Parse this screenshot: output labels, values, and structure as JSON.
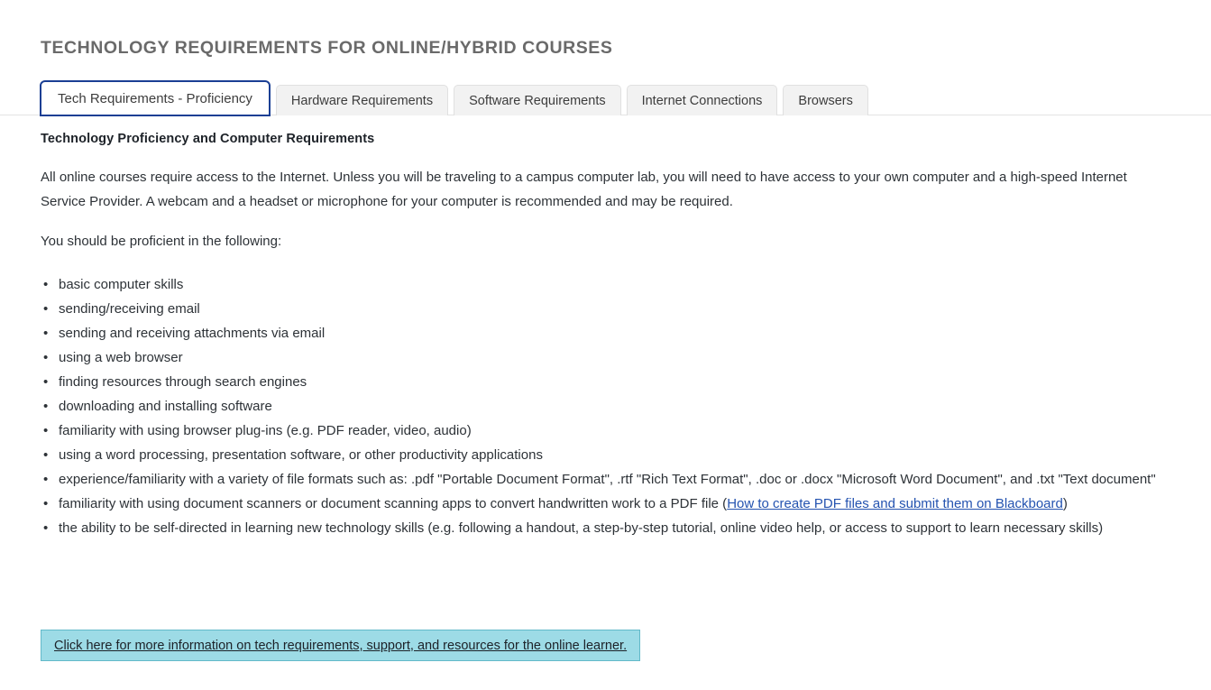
{
  "page": {
    "title": "TECHNOLOGY REQUIREMENTS FOR ONLINE/HYBRID COURSES"
  },
  "tabs": [
    {
      "label": "Tech Requirements - Proficiency",
      "active": true
    },
    {
      "label": "Hardware Requirements",
      "active": false
    },
    {
      "label": "Software Requirements",
      "active": false
    },
    {
      "label": "Internet Connections",
      "active": false
    },
    {
      "label": "Browsers",
      "active": false
    }
  ],
  "content": {
    "heading": "Technology Proficiency and Computer Requirements",
    "intro_paragraph": "All online courses require access to the Internet. Unless you will be traveling to a campus computer lab, you will need to have access to your own computer and a high-speed Internet Service Provider. A webcam and a headset or microphone for your computer is recommended and may be required.",
    "list_lead_in": "You should be proficient in the following:",
    "list_items": [
      {
        "text": "basic computer skills"
      },
      {
        "text": "sending/receiving email"
      },
      {
        "text": "sending and receiving attachments via email"
      },
      {
        "text": "using a web browser"
      },
      {
        "text": "finding resources through search engines"
      },
      {
        "text": "downloading and installing software"
      },
      {
        "text": "familiarity with using browser plug-ins (e.g. PDF reader, video, audio)"
      },
      {
        "text": "using a word processing, presentation software, or other productivity applications"
      },
      {
        "text": "experience/familiarity with a variety of file formats such as: .pdf \"Portable Document Format\", .rtf \"Rich Text Format\", .doc or .docx \"Microsoft Word Document\", and .txt \"Text document\""
      },
      {
        "text_before": "familiarity with using document scanners or document scanning apps to convert handwritten work to a PDF file (",
        "link_text": "How to create PDF files and submit them on Blackboard",
        "text_after": ")"
      },
      {
        "text": "the ability to be self-directed in learning new technology skills (e.g. following a handout, a step-by-step tutorial, online video help, or access to support to learn necessary skills)"
      }
    ]
  },
  "cta": {
    "label": "Click here for more information on tech requirements, support, and resources for the online learner."
  },
  "colors": {
    "active_tab_border": "#1b3f94",
    "link": "#2453b0",
    "cta_background": "#9ddbe6",
    "cta_border": "#62b9c9",
    "title_text": "#6a6a6a"
  }
}
